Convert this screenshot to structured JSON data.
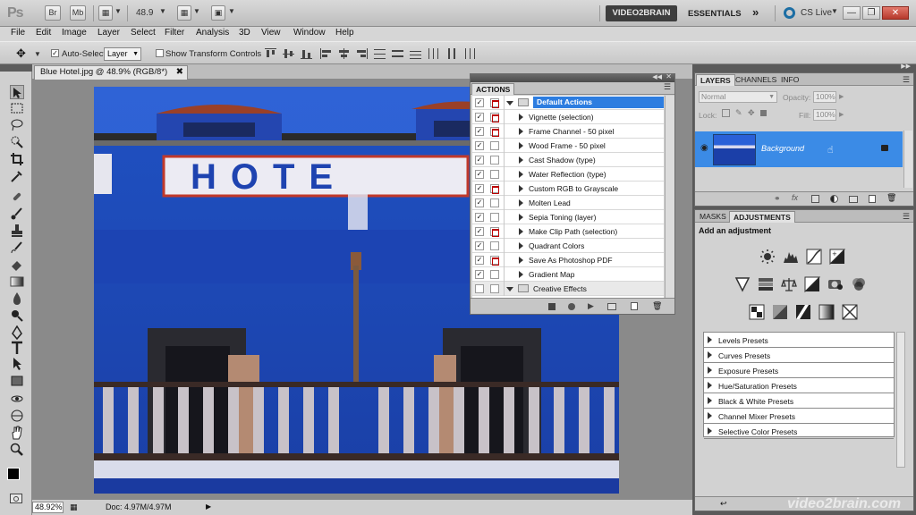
{
  "appbar": {
    "logo": "Ps",
    "bridge": "Br",
    "minibridge": "Mb",
    "zoom_value": "48.9",
    "workspace_active": "VIDEO2BRAIN",
    "workspace_other": "ESSENTIALS",
    "more": "»",
    "cs_live": "CS Live"
  },
  "menu": [
    "File",
    "Edit",
    "Image",
    "Layer",
    "Select",
    "Filter",
    "Analysis",
    "3D",
    "View",
    "Window",
    "Help"
  ],
  "options": {
    "auto_select_label": "Auto-Select:",
    "auto_select_value": "Layer",
    "show_transform_label": "Show Transform Controls"
  },
  "document": {
    "tab_title": "Blue Hotel.jpg @ 48.9% (RGB/8*)",
    "photo_sign": "HOTE",
    "zoom": "48.92%",
    "doc_info": "Doc: 4.97M/4.97M"
  },
  "actions_panel": {
    "tab": "ACTIONS",
    "rows": [
      {
        "name": "Default Actions",
        "kind": "set",
        "checked": true,
        "dialog": true,
        "selected": true
      },
      {
        "name": "Vignette (selection)",
        "kind": "action",
        "checked": true,
        "dialog": true
      },
      {
        "name": "Frame Channel - 50 pixel",
        "kind": "action",
        "checked": true,
        "dialog": true
      },
      {
        "name": "Wood Frame - 50 pixel",
        "kind": "action",
        "checked": true,
        "dialog": false
      },
      {
        "name": "Cast Shadow (type)",
        "kind": "action",
        "checked": true,
        "dialog": false
      },
      {
        "name": "Water Reflection (type)",
        "kind": "action",
        "checked": true,
        "dialog": false
      },
      {
        "name": "Custom RGB to Grayscale",
        "kind": "action",
        "checked": true,
        "dialog": true
      },
      {
        "name": "Molten Lead",
        "kind": "action",
        "checked": true,
        "dialog": false
      },
      {
        "name": "Sepia Toning (layer)",
        "kind": "action",
        "checked": true,
        "dialog": false
      },
      {
        "name": "Make Clip Path (selection)",
        "kind": "action",
        "checked": true,
        "dialog": true
      },
      {
        "name": "Quadrant Colors",
        "kind": "action",
        "checked": true,
        "dialog": false
      },
      {
        "name": "Save As Photoshop PDF",
        "kind": "action",
        "checked": true,
        "dialog": true
      },
      {
        "name": "Gradient Map",
        "kind": "action",
        "checked": true,
        "dialog": false
      },
      {
        "name": "Creative Effects",
        "kind": "set-collapsed",
        "checked": false,
        "dialog": false
      }
    ]
  },
  "layers_panel": {
    "tabs": [
      "LAYERS",
      "CHANNELS",
      "INFO"
    ],
    "blend_mode": "Normal",
    "opacity_label": "Opacity:",
    "opacity_value": "100%",
    "lock_label": "Lock:",
    "fill_label": "Fill:",
    "fill_value": "100%",
    "layer_name": "Background"
  },
  "adjustments_panel": {
    "tabs": [
      "MASKS",
      "ADJUSTMENTS"
    ],
    "title": "Add an adjustment",
    "presets": [
      "Levels Presets",
      "Curves Presets",
      "Exposure Presets",
      "Hue/Saturation Presets",
      "Black & White Presets",
      "Channel Mixer Presets",
      "Selective Color Presets"
    ]
  },
  "watermark": "video2brain.com",
  "colors": {
    "selection_blue": "#2d7de0",
    "layer_highlight": "#3b8be6",
    "sky_blue": "#2a60d8"
  }
}
